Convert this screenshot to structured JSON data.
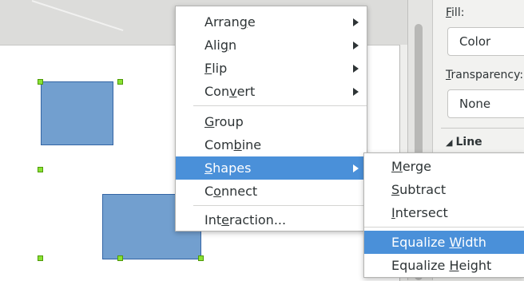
{
  "context_menu": {
    "items": [
      {
        "pre": "Arran",
        "key": "g",
        "post": "e",
        "submenu": true
      },
      {
        "pre": "Ali",
        "key": "g",
        "post": "n",
        "submenu": true
      },
      {
        "pre": "",
        "key": "F",
        "post": "lip",
        "submenu": true
      },
      {
        "pre": "Con",
        "key": "v",
        "post": "ert",
        "submenu": true
      },
      {
        "pre": "",
        "key": "G",
        "post": "roup",
        "submenu": false
      },
      {
        "pre": "Com",
        "key": "b",
        "post": "ine",
        "submenu": false
      },
      {
        "pre": "",
        "key": "S",
        "post": "hapes",
        "submenu": true,
        "active": true
      },
      {
        "pre": "C",
        "key": "o",
        "post": "nnect",
        "submenu": false
      },
      {
        "pre": "Int",
        "key": "e",
        "post": "raction...",
        "submenu": false
      }
    ]
  },
  "shapes_submenu": {
    "items": [
      {
        "pre": "",
        "key": "M",
        "post": "erge"
      },
      {
        "pre": "",
        "key": "S",
        "post": "ubtract"
      },
      {
        "pre": "",
        "key": "I",
        "post": "ntersect"
      },
      {
        "pre": "Equalize ",
        "key": "W",
        "post": "idth",
        "active": true
      },
      {
        "pre": "Equalize ",
        "key": "H",
        "post": "eight"
      }
    ]
  },
  "sidebar": {
    "fill_label": {
      "pre": "",
      "key": "F",
      "post": "ill:"
    },
    "fill_value": "Color",
    "transparency_label": {
      "pre": "",
      "key": "T",
      "post": "ransparency:"
    },
    "transparency_value": "None",
    "line_section": "Line"
  },
  "colors": {
    "shape_fill": "#729fcf",
    "shape_border": "#3465a4",
    "handle": "#8ae234",
    "highlight": "#4a90d9"
  }
}
